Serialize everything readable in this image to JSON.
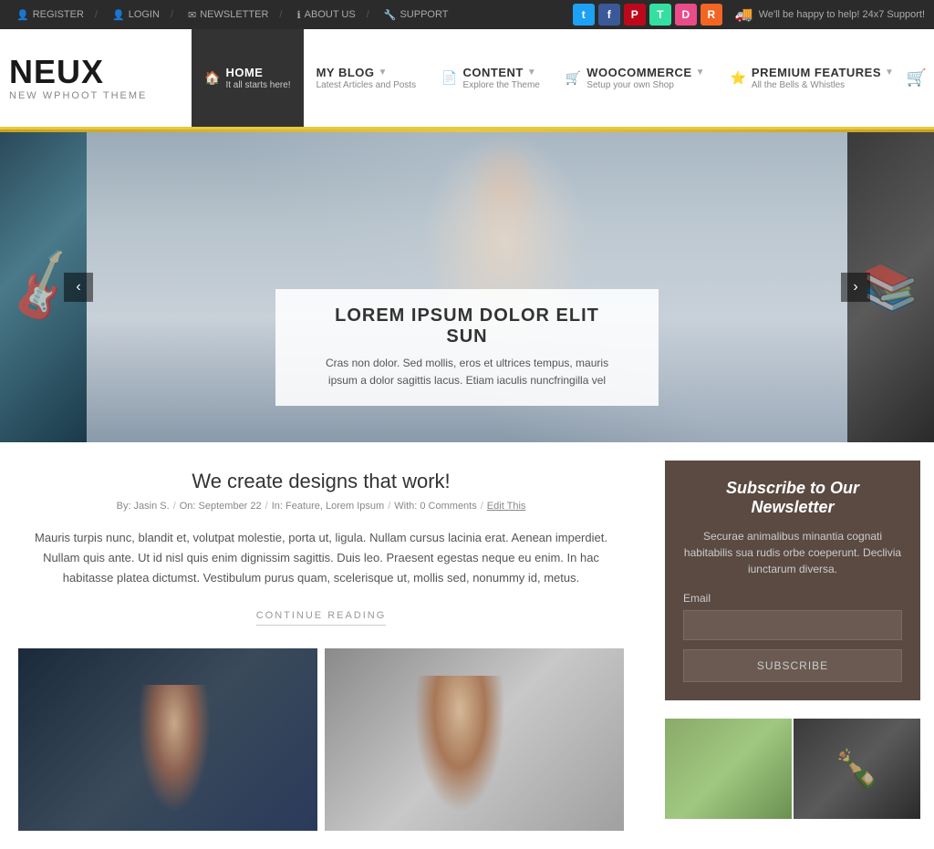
{
  "topbar": {
    "links": [
      {
        "id": "register",
        "label": "REGISTER",
        "icon": "👤"
      },
      {
        "id": "login",
        "label": "LOGIN",
        "icon": "👤"
      },
      {
        "id": "newsletter",
        "label": "NEWSLETTER",
        "icon": "✉"
      },
      {
        "id": "about",
        "label": "ABOUT US",
        "icon": "ℹ"
      },
      {
        "id": "support",
        "label": "SUPPORT",
        "icon": "🔧"
      }
    ],
    "social": [
      {
        "id": "twitter",
        "label": "t",
        "class": "social-twitter"
      },
      {
        "id": "facebook",
        "label": "f",
        "class": "social-facebook"
      },
      {
        "id": "pinterest",
        "label": "P",
        "class": "social-pinterest"
      },
      {
        "id": "tripadvisor",
        "label": "T",
        "class": "social-tripadvisor"
      },
      {
        "id": "dribbble",
        "label": "D",
        "class": "social-dribbble"
      },
      {
        "id": "rss",
        "label": "R",
        "class": "social-rss"
      }
    ],
    "support_text": "We'll be happy to help! 24x7 Support!"
  },
  "header": {
    "logo_title": "NEUX",
    "logo_subtitle": "NEW WPHOOT THEME"
  },
  "nav": {
    "items": [
      {
        "id": "home",
        "icon": "🏠",
        "label": "HOME",
        "sub": "It all starts here!",
        "active": true
      },
      {
        "id": "blog",
        "icon": "",
        "label": "MY BLOG",
        "sub": "Latest Articles and Posts",
        "active": false
      },
      {
        "id": "content",
        "icon": "📄",
        "label": "CONTENT",
        "sub": "Explore the Theme",
        "active": false
      },
      {
        "id": "woocommerce",
        "icon": "🛒",
        "label": "WOOCOMMERCE",
        "sub": "Setup your own Shop",
        "active": false
      },
      {
        "id": "premium",
        "icon": "⭐",
        "label": "PREMIUM FEATURES",
        "sub": "All the Bells & Whistles",
        "active": false
      }
    ]
  },
  "slider": {
    "caption_title": "LOREM IPSUM DOLOR ELIT SUN",
    "caption_text": "Cras non dolor. Sed mollis, eros et ultrices tempus, mauris ipsum a dolor sagittis lacus. Etiam iaculis nuncfringilla vel"
  },
  "article": {
    "title": "We create designs that work!",
    "meta_by": "By: Jasin S.",
    "meta_on": "On: September 22",
    "meta_in": "In: Feature, Lorem Ipsum",
    "meta_with": "With: 0 Comments",
    "meta_edit": "Edit This",
    "body": "Mauris turpis nunc, blandit et, volutpat molestie, porta ut, ligula. Nullam cursus lacinia erat. Aenean imperdiet. Nullam quis ante. Ut id nisl quis enim dignissim sagittis. Duis leo. Praesent egestas neque eu enim. In hac habitasse platea dictumst. Vestibulum purus quam, scelerisque ut, mollis sed, nonummy id, metus.",
    "continue_label": "CONTINUE READING"
  },
  "newsletter": {
    "title": "Subscribe to Our Newsletter",
    "description": "Securae animalibus minantia cognati habitabilis sua rudis orbe coeperunt. Declivia iunctarum diversa.",
    "email_label": "Email",
    "email_placeholder": "",
    "button_label": "SUBSCRIBE"
  }
}
